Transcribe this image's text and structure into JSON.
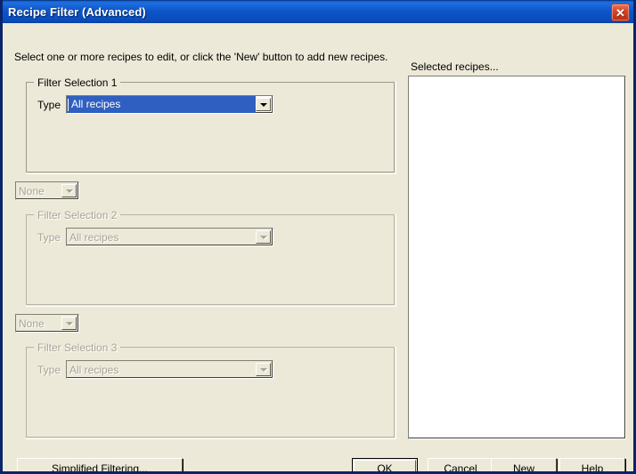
{
  "window": {
    "title": "Recipe Filter (Advanced)",
    "close_icon": "close-icon",
    "close_glyph": "✕",
    "titlebar_color": "#0a4cbd",
    "face_color": "#ece9d8",
    "close_color": "#c0392b"
  },
  "instruction": "Select one or more recipes to edit, or click the 'New' button to add new recipes.",
  "filters": [
    {
      "group_title": "Filter Selection 1",
      "type_label": "Type",
      "type_value": "All recipes",
      "disabled": false,
      "focused": true
    },
    {
      "group_title": "Filter Selection 2",
      "type_label": "Type",
      "type_value": "All recipes",
      "disabled": true,
      "focused": false
    },
    {
      "group_title": "Filter Selection 3",
      "type_label": "Type",
      "type_value": "All recipes",
      "disabled": true,
      "focused": false
    }
  ],
  "operators": [
    {
      "value": "None",
      "disabled": true
    },
    {
      "value": "None",
      "disabled": true
    }
  ],
  "selected_panel": {
    "label": "Selected recipes...",
    "items": []
  },
  "buttons": {
    "simplified": {
      "prefix": "",
      "accel": "S",
      "suffix": "implified Filtering..."
    },
    "ok": {
      "prefix": "OK",
      "accel": "",
      "suffix": ""
    },
    "cancel": {
      "prefix": "Cancel",
      "accel": "",
      "suffix": ""
    },
    "new": {
      "prefix": "",
      "accel": "N",
      "suffix": "ew"
    },
    "help": {
      "prefix": "",
      "accel": "H",
      "suffix": "elp"
    }
  }
}
